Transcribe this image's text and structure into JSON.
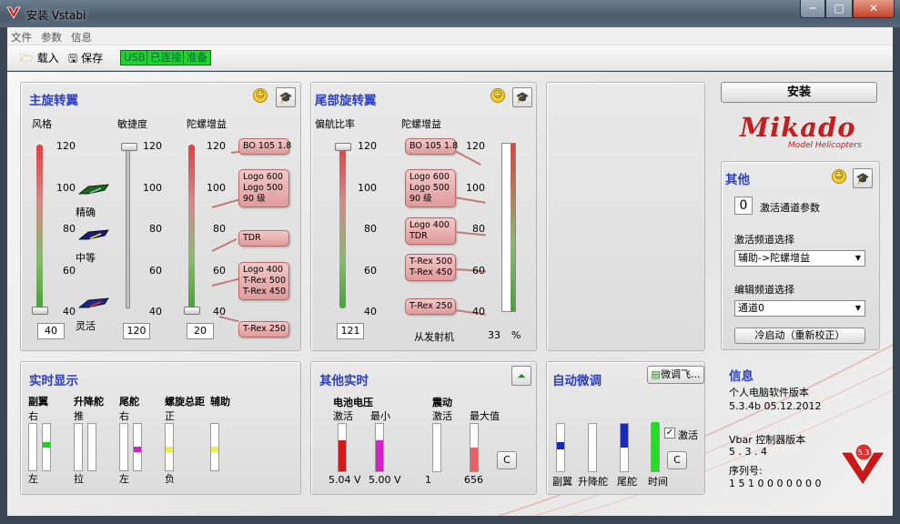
{
  "window": {
    "title": "安装 Vstabi",
    "min": "─",
    "max": "□",
    "close": "✕"
  },
  "menu": [
    "文件",
    "参数",
    "信息"
  ],
  "toolbar": {
    "load": "载入",
    "save": "保存",
    "usb": "USB",
    "connected": "已连接",
    "ready": "准备"
  },
  "main_rotor": {
    "title": "主旋转翼",
    "col_style": "风格",
    "col_agility": "敏捷度",
    "col_gyro": "陀螺增益",
    "ticks": [
      "120",
      "100",
      "80",
      "60",
      "40"
    ],
    "styles": [
      "精确",
      "中等",
      "灵活"
    ],
    "style_value": "40",
    "agility_value": "120",
    "gyro_value": "20",
    "callouts": [
      "BO 105 1.8",
      "Logo 600\nLogo 500\n90 级",
      "TDR",
      "Logo 400\nT-Rex 500\nT-Rex 450",
      "T-Rex 250"
    ]
  },
  "tail_rotor": {
    "title": "尾部旋转翼",
    "col_yaw": "偏航比率",
    "col_gyro": "陀螺增益",
    "ticks": [
      "120",
      "100",
      "80",
      "60",
      "40"
    ],
    "yaw_value": "121",
    "callouts": [
      "BO 105 1.8",
      "Logo 600\nLogo 500\n90 级",
      "Logo 400\nTDR",
      "T-Rex 500\nT-Rex 450",
      "T-Rex 250"
    ],
    "from_tx_label": "从发射机",
    "from_tx_value": "33",
    "unit": "%",
    "gyro_fraction": 0.33
  },
  "install_button": "安装",
  "logo": {
    "brand": "Mikado",
    "sub": "Model Helicopters"
  },
  "other": {
    "title": "其他",
    "activate_count": "0",
    "activate_label": "激活通道参数",
    "activate_sel_label": "激活频道选择",
    "activate_sel_value": "辅助->陀螺增益",
    "edit_sel_label": "编辑频道选择",
    "edit_sel_value": "通道0",
    "cold_start": "冷启动（重新校正）"
  },
  "realtime": {
    "title": "实时显示",
    "groups": [
      {
        "label": "副翼",
        "top": "右",
        "bottom": "左"
      },
      {
        "label": "升降舵",
        "top": "推",
        "bottom": "拉"
      },
      {
        "label": "尾舵",
        "top": "右",
        "bottom": "左"
      },
      {
        "label": "螺旋总距",
        "top": "正",
        "bottom": "负"
      },
      {
        "label": "辅助",
        "top": "",
        "bottom": ""
      }
    ],
    "colors": [
      "#22cc22",
      "#cc22cc",
      "#eeee44"
    ]
  },
  "other_realtime": {
    "title": "其他实时",
    "voltage": "电池电压",
    "vib": "震动",
    "col_active": "激活",
    "col_min": "最小",
    "col_max": "最大值",
    "v_active": "5.04",
    "v_min": "5.00",
    "v_unit": "V",
    "vib_active": "1",
    "vib_max": "656",
    "c_button": "C"
  },
  "auto_trim": {
    "title": "自动微调",
    "trim_button": "微调飞...",
    "activate_label": "激活",
    "c_button": "C",
    "labels": [
      "副翼",
      "升降舵",
      "尾舵",
      "时间"
    ]
  },
  "info": {
    "title": "信息",
    "pc_version_label": "个人电脑软件版本",
    "pc_version": "5.3.4b  05.12.2012",
    "vbar_label": "Vbar 控制器版本",
    "vbar_version": "5 . 3 . 4",
    "serial_label": "序列号:",
    "serial": "1 5 1 0 0 0 0 0 0 0"
  },
  "colors": {
    "title_blue": "#2d3fbd",
    "status_green": "#22d034"
  }
}
